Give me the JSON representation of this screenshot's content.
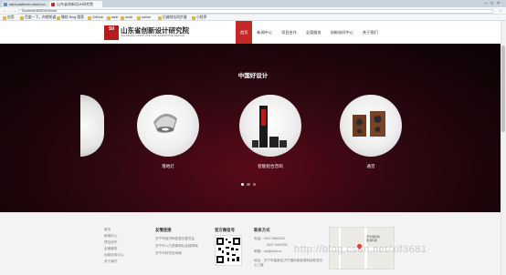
{
  "browser": {
    "tabs": [
      {
        "label": "sdut.platform.cabid.co..."
      },
      {
        "label": "山东省创新设计研究院"
      }
    ],
    "window_controls": "–□×",
    "nav_glyphs": "← → ↻",
    "url": "localhost:8080/#/home",
    "bookmarks": [
      "应用",
      "百度一下，你就知道",
      "微软 Bing 搜索",
      "GitHub",
      "web",
      "work",
      "online",
      "后端地址同步器",
      "小程序"
    ]
  },
  "site": {
    "logo_mark": "SII",
    "logo_cn": "山东省创新设计研究院",
    "logo_en": "SHANDONG INSTITUTE FOR INNOVATIVE DESIGN",
    "menu": [
      "首页",
      "新闻中心",
      "项目合作",
      "全案服务",
      "创新协同中心",
      "关于我们"
    ],
    "active_menu": "首页"
  },
  "hero": {
    "title": "中国好设计",
    "products": [
      {
        "caption": "落地灯"
      },
      {
        "caption": "智能组合音响"
      },
      {
        "caption": "通音"
      }
    ],
    "carousel_dots": 3,
    "carousel_active": 1
  },
  "footer": {
    "nav_links": [
      "首页",
      "新闻中心",
      "项目合作",
      "全案服务",
      "创新协同中心",
      "关于我们"
    ],
    "friend_title": "友情连接",
    "friend_links": [
      "济宁市经济和信息化委员会",
      "济宁市人力资源和社会保障局",
      "济宁市科学技术局"
    ],
    "wechat_title": "官方微信号",
    "contact_title": "联系方式",
    "contact_lines": [
      "电话：0537-5662353",
      "0537-5662352",
      "邮箱：sid@sdid.cn",
      "地址：济宁市高新区济宁国际新能源科技研发中心三楼"
    ],
    "map_labels": [
      "济宁国际新",
      "能源科技"
    ],
    "watermark": "http://blog.csdn.net/xif3681"
  }
}
